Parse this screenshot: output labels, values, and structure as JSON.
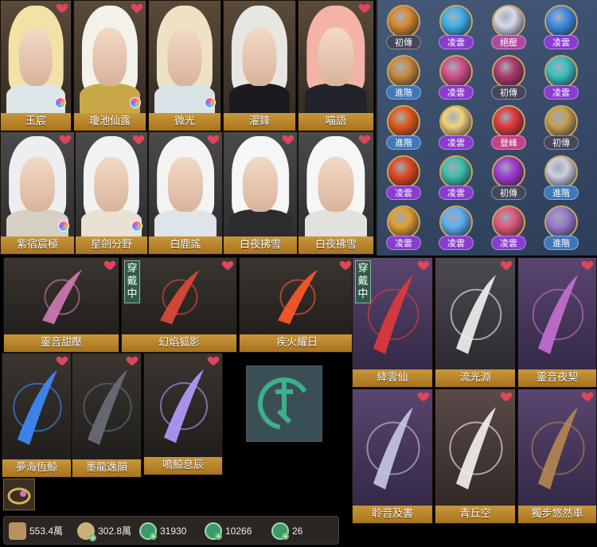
{
  "characters_row1": [
    {
      "name": "玉宸",
      "hair": "#f1e3a8",
      "robe": "#dfe6ea"
    },
    {
      "name": "瓊池仙露",
      "hair": "#f4f1ea",
      "robe": "#c9a84a"
    },
    {
      "name": "微光",
      "hair": "#efe2c4",
      "robe": "#d9e2e6"
    },
    {
      "name": "濯鋒",
      "hair": "#e8e6e2",
      "robe": "#1b1b1f"
    },
    {
      "name": "喵語",
      "hair": "#f3b3a5",
      "robe": "#22232a"
    }
  ],
  "characters_row2": [
    {
      "name": "紫宿宸極",
      "hair": "#eeeef0",
      "robe": "#d6cfc4"
    },
    {
      "name": "星劍分野",
      "hair": "#f2f2f2",
      "robe": "#e8e1d4"
    },
    {
      "name": "白鹿謠",
      "hair": "#f4f4f4",
      "robe": "#dfe4e8"
    },
    {
      "name": "白夜拂雪",
      "hair": "#f6f6f6",
      "robe": "#2b2b30"
    },
    {
      "name": "白夜拂雪",
      "hair": "#f6f6f6",
      "robe": "#e2e2dc"
    }
  ],
  "wearing_label": "穿戴中",
  "weapons_row1": [
    {
      "name": "靈音甜壓",
      "color": "#d27ab4"
    },
    {
      "name": "幻焰狐影",
      "color": "#e04a3a"
    },
    {
      "name": "疾火耀日",
      "color": "#ff5a2a"
    }
  ],
  "weapons_row2": [
    {
      "name": "夢海恆鯨",
      "color": "#3f8cff"
    },
    {
      "name": "墨龍逸韻",
      "color": "#6a6f7a"
    },
    {
      "name": "鳴鯨息辰",
      "color": "#b79cff"
    }
  ],
  "mounts_row1": [
    {
      "name": "絳雲仙",
      "color": "#e23a3a"
    },
    {
      "name": "流光淵",
      "color": "#f2f2f2"
    },
    {
      "name": "靈音夜契",
      "color": "#c76fd1"
    }
  ],
  "mounts_row2": [
    {
      "name": "聆音及書",
      "color": "#c6c8e8"
    },
    {
      "name": "青丘空",
      "color": "#f5f2ee"
    },
    {
      "name": "獨步悠然車",
      "color": "#b58650"
    }
  ],
  "skills": [
    [
      "初傳",
      "凌雲",
      "絕壓",
      "凌雲"
    ],
    [
      "進階",
      "凌雲",
      "初傳",
      "凌雲"
    ],
    [
      "進階",
      "凌雲",
      "登峰",
      "初傳"
    ],
    [
      "凌雲",
      "凌雲",
      "初傳",
      "進階"
    ],
    [
      "凌雲",
      "凌雲",
      "凌雲",
      "進階"
    ]
  ],
  "skill_colors": [
    [
      "#d8892c",
      "#3fb0e8",
      "#d9d9e8",
      "#3f8be0"
    ],
    [
      "#c98a3a",
      "#d2508a",
      "#b03a6a",
      "#3ac0c0"
    ],
    [
      "#e25a1a",
      "#f2d27a",
      "#e03a3a",
      "#c4a050"
    ],
    [
      "#e04a20",
      "#3fbfaa",
      "#a33ad0",
      "#cfcfdf"
    ],
    [
      "#e0a030",
      "#5fb0f0",
      "#e05a7a",
      "#9a7ad0"
    ]
  ],
  "resources": [
    {
      "icon": "scroll-icon",
      "value": "553.4萬"
    },
    {
      "icon": "coin-icon",
      "value": "302.8萬"
    },
    {
      "icon": "jade-icon",
      "value": "31930"
    },
    {
      "icon": "jade-icon",
      "value": "10266"
    },
    {
      "icon": "jade-icon",
      "value": "26"
    }
  ]
}
